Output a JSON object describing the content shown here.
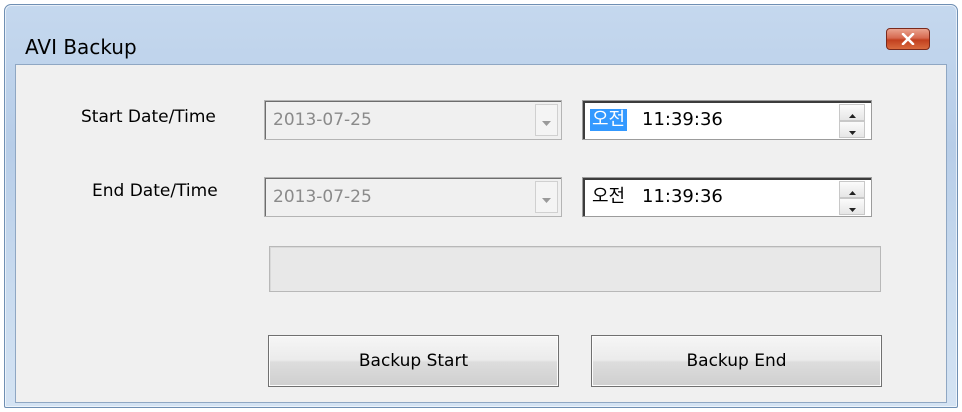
{
  "window": {
    "title": "AVI Backup",
    "close_icon": "close-icon"
  },
  "start": {
    "label": "Start Date/Time",
    "date": "2013-07-25",
    "ampm": "오전",
    "time": "11:39:36"
  },
  "end": {
    "label": "End Date/Time",
    "date": "2013-07-25",
    "ampm": "오전",
    "time": "11:39:36"
  },
  "progress": {
    "value": 0
  },
  "buttons": {
    "start": "Backup Start",
    "end": "Backup End"
  },
  "colors": {
    "selection": "#3399ff",
    "close_button": "#c8452a",
    "progress_fill": "#37b34a"
  }
}
